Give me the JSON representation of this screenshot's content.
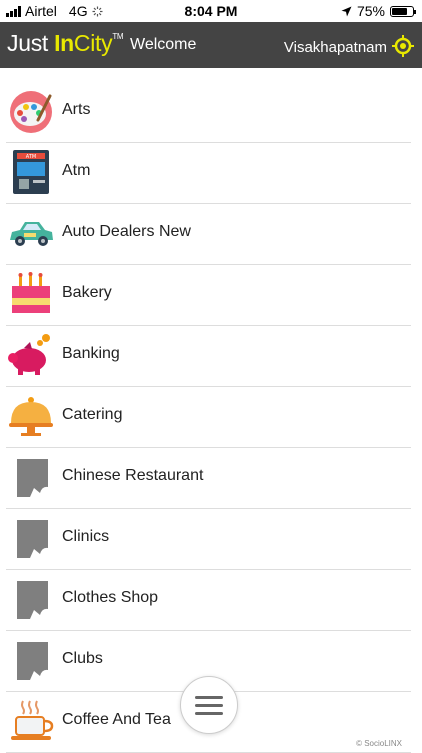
{
  "status_bar": {
    "carrier": "Airtel",
    "network": "4G",
    "time": "8:04 PM",
    "battery": "75%",
    "battery_level": 0.75
  },
  "header": {
    "logo_just": "Just",
    "logo_in": "In",
    "logo_city": "City",
    "logo_tm": "TM",
    "welcome": "Welcome",
    "city": "Visakhapatnam",
    "location_icon": "location-target-icon"
  },
  "categories": [
    {
      "label": "Arts",
      "icon": "palette-icon"
    },
    {
      "label": "Atm",
      "icon": "atm-icon"
    },
    {
      "label": "Auto Dealers New",
      "icon": "car-icon"
    },
    {
      "label": "Bakery",
      "icon": "cake-icon"
    },
    {
      "label": "Banking",
      "icon": "piggy-bank-icon"
    },
    {
      "label": "Catering",
      "icon": "food-cloche-icon"
    },
    {
      "label": "Chinese Restaurant",
      "icon": "placeholder-icon"
    },
    {
      "label": "Clinics",
      "icon": "placeholder-icon"
    },
    {
      "label": "Clothes Shop",
      "icon": "placeholder-icon"
    },
    {
      "label": "Clubs",
      "icon": "placeholder-icon"
    },
    {
      "label": "Coffee And Tea",
      "icon": "coffee-cup-icon"
    }
  ],
  "menu_button": {
    "icon": "hamburger-menu-icon"
  },
  "footer": {
    "credit": "© SocioLINX"
  },
  "colors": {
    "header_bg": "#444444",
    "logo_accent": "#e8e800"
  }
}
